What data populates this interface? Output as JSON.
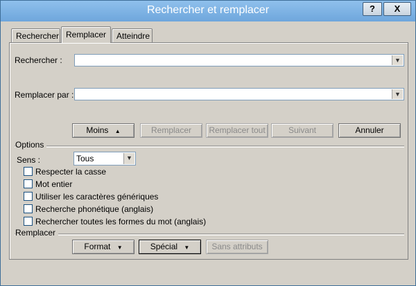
{
  "window": {
    "title": "Rechercher et remplacer",
    "help_label": "?",
    "close_label": "X"
  },
  "tabs": [
    {
      "label": "Rechercher"
    },
    {
      "label": "Remplacer",
      "active": true
    },
    {
      "label": "Atteindre"
    }
  ],
  "find": {
    "label": "Rechercher :",
    "value": ""
  },
  "replace": {
    "label": "Remplacer par :",
    "value": ""
  },
  "buttons": {
    "less": "Moins",
    "replace": "Remplacer",
    "replace_all": "Remplacer tout",
    "next": "Suivant",
    "cancel": "Annuler"
  },
  "options": {
    "section_label": "Options",
    "direction_label": "Sens :",
    "direction_value": "Tous",
    "checkboxes": [
      {
        "label": "Respecter la casse",
        "checked": false
      },
      {
        "label": "Mot entier",
        "checked": false
      },
      {
        "label": "Utiliser les caractères génériques",
        "checked": false
      },
      {
        "label": "Recherche phonétique (anglais)",
        "checked": false
      },
      {
        "label": "Rechercher toutes les formes du mot (anglais)",
        "checked": false
      }
    ]
  },
  "replace_section": {
    "section_label": "Remplacer",
    "format": "Format",
    "special": "Spécial",
    "no_attributes": "Sans attributs"
  },
  "icons": {
    "dropdown": "chevron-down-icon",
    "less_arrow": "triangle-up-icon",
    "menu_arrow": "triangle-down-icon"
  }
}
